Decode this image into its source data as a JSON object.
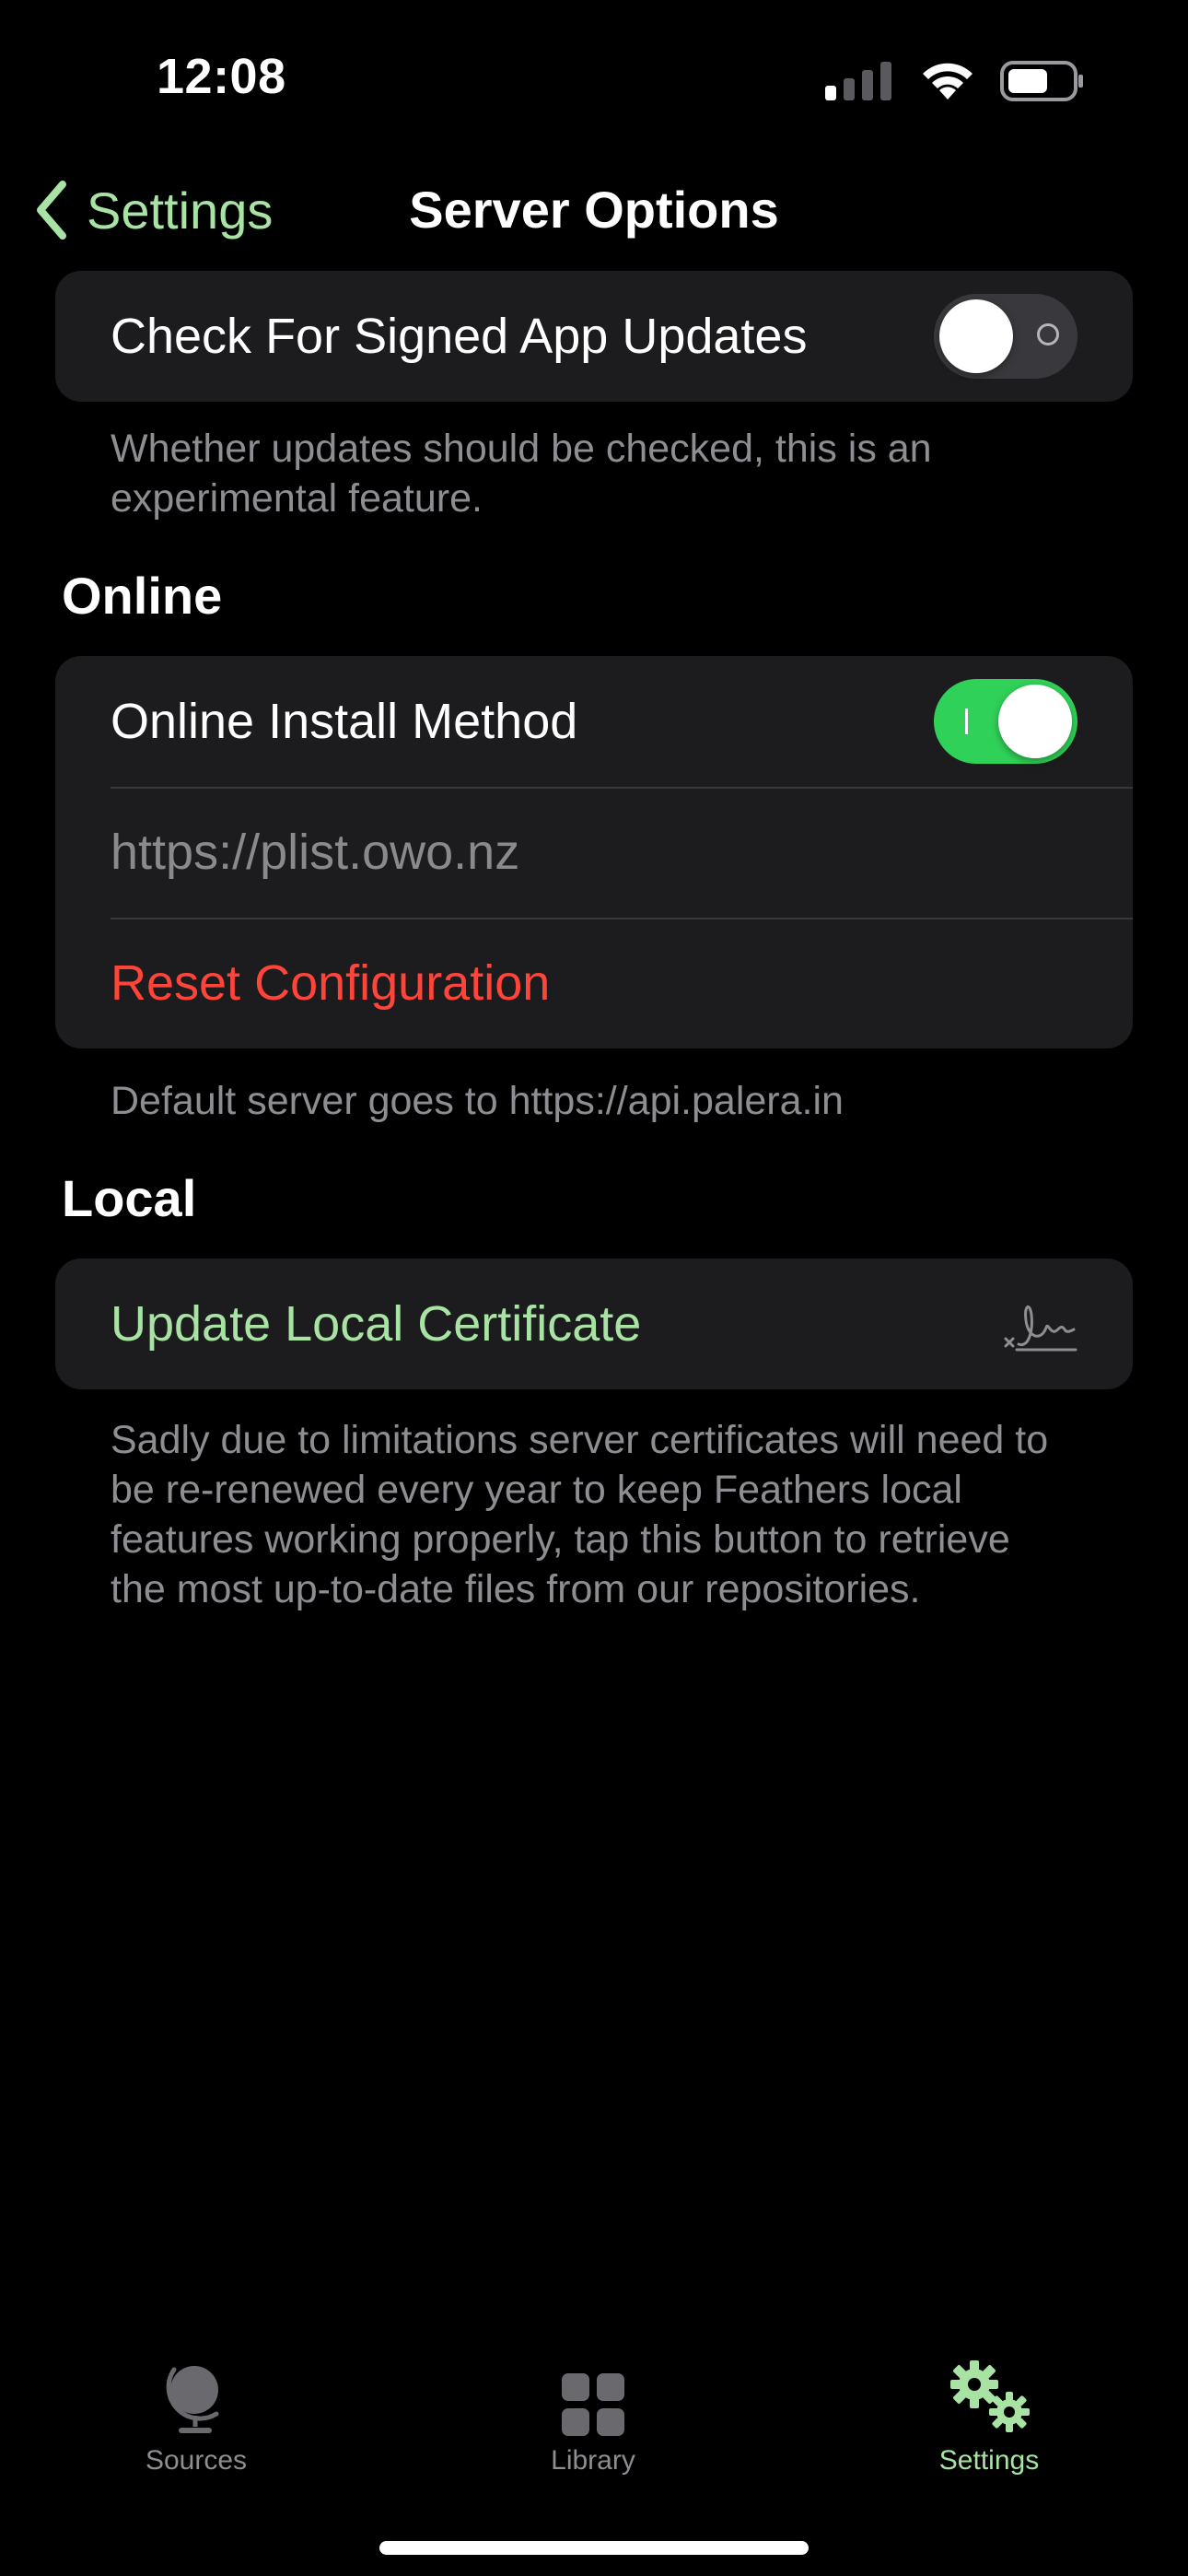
{
  "colors": {
    "accent": "#a8e3a4",
    "switch_on": "#30d158",
    "destructive": "#ff453a"
  },
  "status_bar": {
    "time": "12:08"
  },
  "nav": {
    "back_label": "Settings",
    "title": "Server Options"
  },
  "updates_group": {
    "check_updates_label": "Check For Signed App Updates",
    "check_updates_on": false,
    "footer": "Whether updates should be checked, this is an experimental feature."
  },
  "online": {
    "header": "Online",
    "install_method_label": "Online Install Method",
    "install_method_on": true,
    "server_field_placeholder": "https://plist.owo.nz",
    "reset_label": "Reset Configuration",
    "footer": "Default server goes to https://api.palera.in"
  },
  "local": {
    "header": "Local",
    "update_cert_label": "Update Local Certificate",
    "update_cert_icon": "signature-icon",
    "footer": "Sadly due to limitations server certificates will need to be re-renewed every year to keep Feathers local features working properly, tap this button to retrieve the most up-to-date files from our repositories."
  },
  "tab_bar": {
    "tabs": [
      {
        "label": "Sources",
        "icon": "globe-icon",
        "active": false
      },
      {
        "label": "Library",
        "icon": "grid-icon",
        "active": false
      },
      {
        "label": "Settings",
        "icon": "gears-icon",
        "active": true
      }
    ]
  }
}
